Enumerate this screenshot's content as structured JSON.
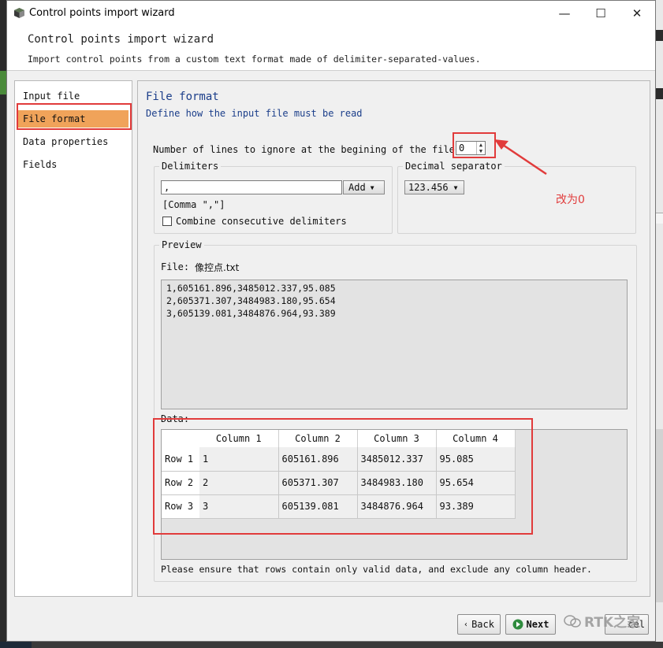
{
  "window": {
    "title": "Control points import wizard",
    "minimize": "—",
    "maximize": "☐",
    "close": "✕"
  },
  "header": {
    "title": "Control points import wizard",
    "subtitle": "Import control points from a custom text format made of delimiter-separated-values."
  },
  "nav": {
    "items": [
      {
        "label": "Input file"
      },
      {
        "label": "File format"
      },
      {
        "label": "Data properties"
      },
      {
        "label": "Fields"
      }
    ],
    "selected": "File format"
  },
  "section": {
    "title": "File format",
    "subtitle": "Define how the input file must be read"
  },
  "ignore_lines": {
    "label": "Number of lines to ignore at the begining of the file:",
    "value": "0"
  },
  "delimiters": {
    "title": "Delimiters",
    "value": ",",
    "add_label": "Add",
    "description": "[Comma \",\"]",
    "combine_label": "Combine consecutive delimiters",
    "combine_checked": false
  },
  "decimal": {
    "title": "Decimal separator",
    "value": "123.456"
  },
  "preview": {
    "title": "Preview",
    "file_label": "File:",
    "file_name": "像控点.txt",
    "lines": [
      "1,605161.896,3485012.337,95.085",
      "2,605371.307,3484983.180,95.654",
      "3,605139.081,3484876.964,93.389"
    ],
    "data_label": "Data:",
    "columns": [
      "Column 1",
      "Column 2",
      "Column 3",
      "Column 4"
    ],
    "rows": [
      {
        "header": "Row 1",
        "cells": [
          "1",
          "605161.896",
          "3485012.337",
          "95.085"
        ]
      },
      {
        "header": "Row 2",
        "cells": [
          "2",
          "605371.307",
          "3484983.180",
          "95.654"
        ]
      },
      {
        "header": "Row 3",
        "cells": [
          "3",
          "605139.081",
          "3484876.964",
          "93.389"
        ]
      }
    ],
    "note": "Please ensure that rows contain only valid data, and exclude any column header."
  },
  "buttons": {
    "back": "Back",
    "next": "Next",
    "cancel": "Cancel"
  },
  "annotation": {
    "text": "改为0",
    "color": "#e13b3b"
  },
  "watermark": "RTK之家"
}
